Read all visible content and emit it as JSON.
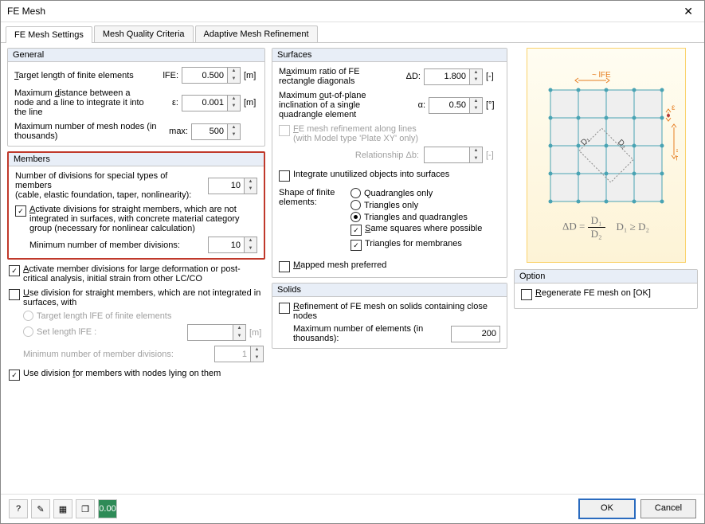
{
  "window": {
    "title": "FE Mesh"
  },
  "tabs": [
    {
      "label": "FE Mesh Settings",
      "active": true
    },
    {
      "label": "Mesh Quality Criteria",
      "active": false
    },
    {
      "label": "Adaptive Mesh Refinement",
      "active": false
    }
  ],
  "general": {
    "title": "General",
    "target_len_label": "Target length of finite elements",
    "target_len_sym": "lFE:",
    "target_len_val": "0.500",
    "target_len_unit": "[m]",
    "max_dist_label": "Maximum distance between a node and a line to integrate it into the line",
    "max_dist_sym": "ε:",
    "max_dist_val": "0.001",
    "max_dist_unit": "[m]",
    "max_nodes_label": "Maximum number of mesh nodes (in thousands)",
    "max_nodes_sym": "max:",
    "max_nodes_val": "500"
  },
  "members": {
    "title": "Members",
    "div_special_label": "Number of divisions for special types of members",
    "div_special_sub": "(cable, elastic foundation, taper, nonlinearity):",
    "div_special_val": "10",
    "activate_div_label": "Activate divisions for straight members, which are not integrated in surfaces, with concrete material category group (necessary for nonlinear calculation)",
    "min_div_label": "Minimum number of member divisions:",
    "min_div_val": "10",
    "activate_large_def_label": "Activate member divisions for large deformation or post-critical analysis, initial strain from other LC/CO",
    "use_div_straight_label": "Use division for straight members, which are not integrated in surfaces, with",
    "opt_target_len": "Target length lFE of finite elements",
    "opt_set_len": "Set length lFE :",
    "opt_set_len_unit": "[m]",
    "min_div2_label": "Minimum number of member divisions:",
    "min_div2_val": "1",
    "use_div_nodes_label": "Use division for members with nodes lying on them"
  },
  "surfaces": {
    "title": "Surfaces",
    "max_ratio_label": "Maximum ratio of FE rectangle diagonals",
    "max_ratio_sym": "ΔD:",
    "max_ratio_val": "1.800",
    "max_ratio_unit": "[-]",
    "max_oop_label": "Maximum out-of-plane inclination of a single quadrangle element",
    "max_oop_sym": "α:",
    "max_oop_val": "0.50",
    "max_oop_unit": "[°]",
    "refine_lines_label": "FE mesh refinement along lines (with Model type 'Plate XY' only)",
    "relationship_label": "Relationship  Δb:",
    "relationship_unit": "[-]",
    "integrate_unused_label": "Integrate unutilized objects into surfaces",
    "shape_label": "Shape of finite elements:",
    "shape_quad": "Quadrangles only",
    "shape_tri": "Triangles only",
    "shape_both": "Triangles and quadrangles",
    "same_sq_label": "Same squares where possible",
    "tri_memb_label": "Triangles for membranes",
    "mapped_label": "Mapped mesh preferred"
  },
  "solids": {
    "title": "Solids",
    "refine_label": "Refinement of FE mesh on solids containing close nodes",
    "max_el_label": "Maximum number of elements (in thousands):",
    "max_el_val": "200"
  },
  "option": {
    "title": "Option",
    "regen_label": "Regenerate FE mesh on [OK]"
  },
  "diagram": {
    "lfe": "~ lFE",
    "eps": "ε",
    "d1": "D₁",
    "d2": "D₂",
    "mlfe": "~lFE",
    "formula_lhs": "ΔD =",
    "formula_num": "D₁",
    "formula_den": "D₂",
    "formula_cond": "D₁ ≥ D₂"
  },
  "footer": {
    "ok": "OK",
    "cancel": "Cancel",
    "icons": [
      "help-icon",
      "edit-icon",
      "table-icon",
      "copy-icon",
      "calc-icon"
    ]
  }
}
